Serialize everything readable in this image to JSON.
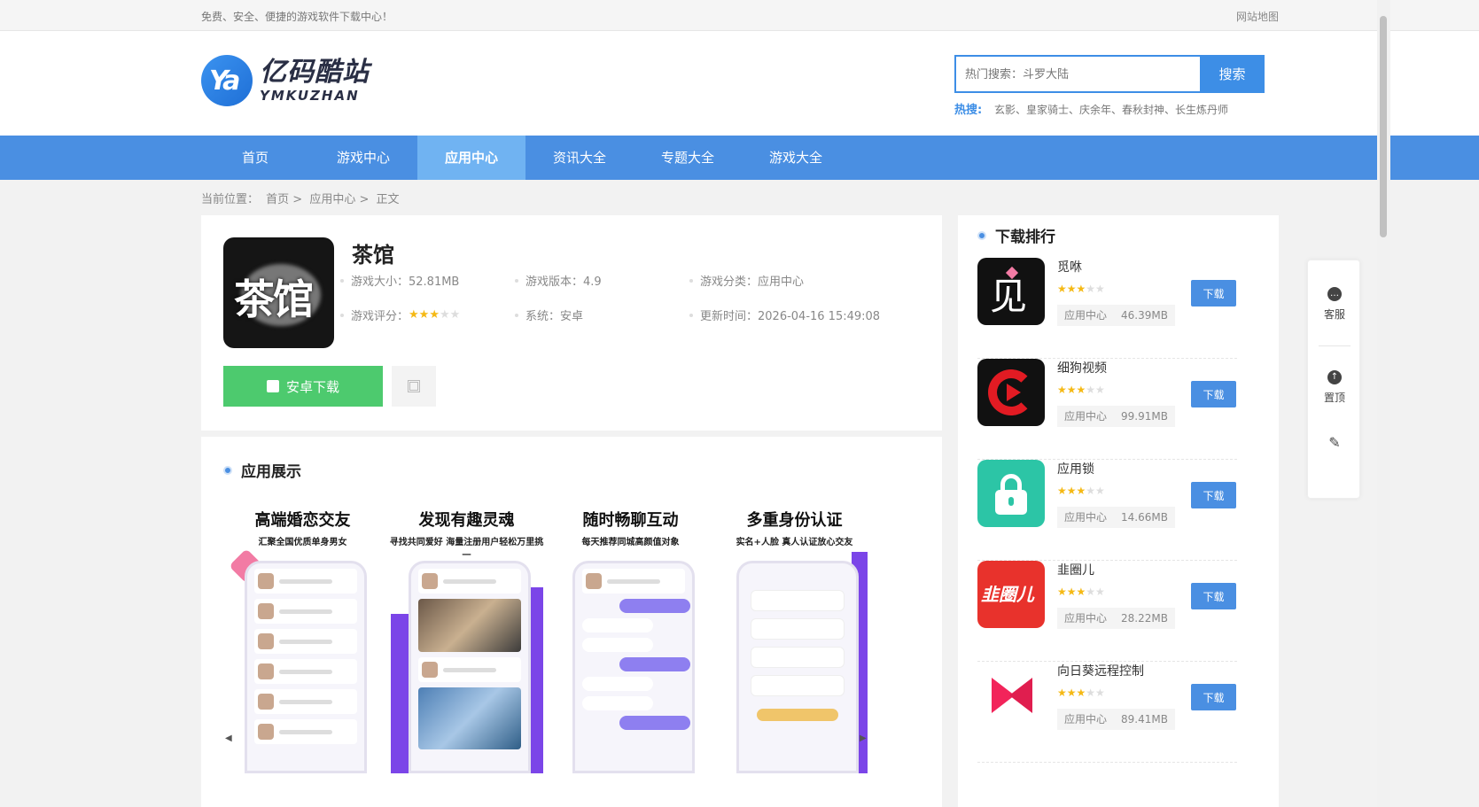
{
  "topbar": {
    "slogan": "免费、安全、便捷的游戏软件下载中心！",
    "sitemap": "网站地图"
  },
  "logo": {
    "mark": "Ya",
    "cn": "亿码酷站",
    "en": "YMKUZHAN"
  },
  "search": {
    "placeholder": "热门搜索：斗罗大陆",
    "button": "搜索",
    "hot_label": "热搜:",
    "hot_terms": "玄影、皇家骑士、庆余年、春秋封神、长生炼丹师"
  },
  "nav": {
    "items": [
      "首页",
      "游戏中心",
      "应用中心",
      "资讯大全",
      "专题大全",
      "游戏大全"
    ],
    "active": "应用中心"
  },
  "breadcrumb": {
    "label": "当前位置：",
    "items": [
      "首页 >",
      "应用中心 >",
      "正文"
    ]
  },
  "app": {
    "icon_text": "茶馆",
    "title": "茶馆",
    "size": "游戏大小：52.81MB",
    "version": "游戏版本：4.9",
    "category": "游戏分类：应用中心",
    "rating_label": "游戏评分：",
    "rating": 3,
    "system": "系统：安卓",
    "updated": "更新时间：2026-04-16 15:49:08",
    "download_button": "安卓下载"
  },
  "showcase": {
    "title": "应用展示",
    "screens": [
      {
        "title": "高端婚恋交友",
        "subtitle": "汇聚全国优质单身男女"
      },
      {
        "title": "发现有趣灵魂",
        "subtitle": "寻找共同爱好 海量注册用户轻松万里挑一"
      },
      {
        "title": "随时畅聊互动",
        "subtitle": "每天推荐同城高颜值对象"
      },
      {
        "title": "多重身份认证",
        "subtitle": "实名+人脸 真人认证放心交友"
      }
    ]
  },
  "ranking": {
    "title": "下载排行",
    "items": [
      {
        "name": "觅咻",
        "rating": 3,
        "category": "应用中心",
        "size": "46.39MB",
        "button": "下载",
        "icon_color": "#111111",
        "icon_glyph": "见"
      },
      {
        "name": "细狗视频",
        "rating": 3,
        "category": "应用中心",
        "size": "99.91MB",
        "button": "下载",
        "icon_color": "#111111",
        "icon_glyph": ""
      },
      {
        "name": "应用锁",
        "rating": 3,
        "category": "应用中心",
        "size": "14.66MB",
        "button": "下载",
        "icon_color": "#2cc5a6",
        "icon_glyph": ""
      },
      {
        "name": "韭圈儿",
        "rating": 3,
        "category": "应用中心",
        "size": "28.22MB",
        "button": "下载",
        "icon_color": "#e8322c",
        "icon_glyph": "韭圈儿"
      },
      {
        "name": "向日葵远程控制",
        "rating": 3,
        "category": "应用中心",
        "size": "89.41MB",
        "button": "下载",
        "icon_color": "#ffffff",
        "icon_glyph": ""
      }
    ]
  },
  "float_bar": {
    "service": "客服",
    "top": "置顶"
  }
}
